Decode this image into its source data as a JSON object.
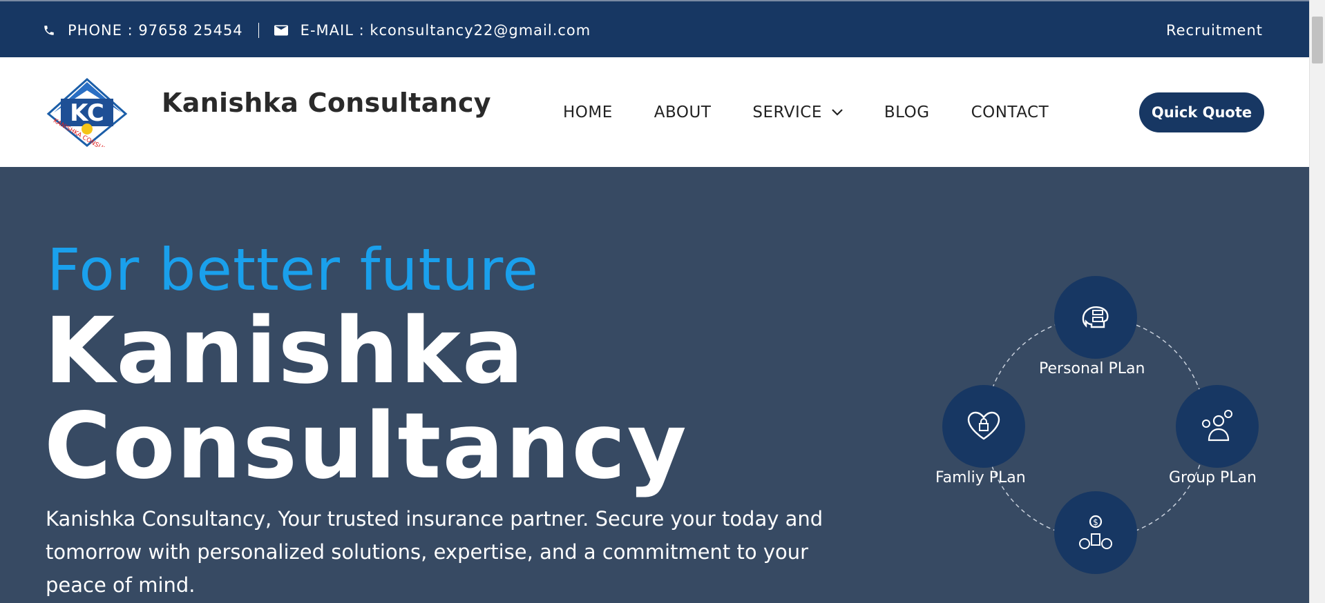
{
  "topbar": {
    "phone": "PHONE : 97658 25454",
    "email": "E-MAIL : kconsultancy22@gmail.com",
    "recruitment": "Recruitment"
  },
  "header": {
    "brand": "Kanishka Consultancy",
    "logo_text": "KANISHKA CONSULTANCY",
    "nav": [
      "HOME",
      "ABOUT",
      "SERVICE",
      "BLOG",
      "CONTACT"
    ],
    "cta": "Quick Quote"
  },
  "hero": {
    "tagline": "For better future",
    "title_line1": "Kanishka",
    "title_line2": "Consultancy",
    "description": "Kanishka Consultancy, Your trusted insurance partner. Secure your today and tomorrow with personalized solutions, expertise, and a commitment to your peace of mind.",
    "plans": [
      {
        "label": "Personal PLan",
        "icon": "brain-gear-icon"
      },
      {
        "label": "Famliy PLan",
        "icon": "heart-lock-icon"
      },
      {
        "label": "Group PLan",
        "icon": "person-gears-icon"
      },
      {
        "label": "",
        "icon": "money-people-icon"
      }
    ]
  },
  "colors": {
    "navy": "#173763",
    "hero_bg": "#374a63",
    "accent_blue": "#1aa0ec",
    "logo_red": "#e02020"
  }
}
